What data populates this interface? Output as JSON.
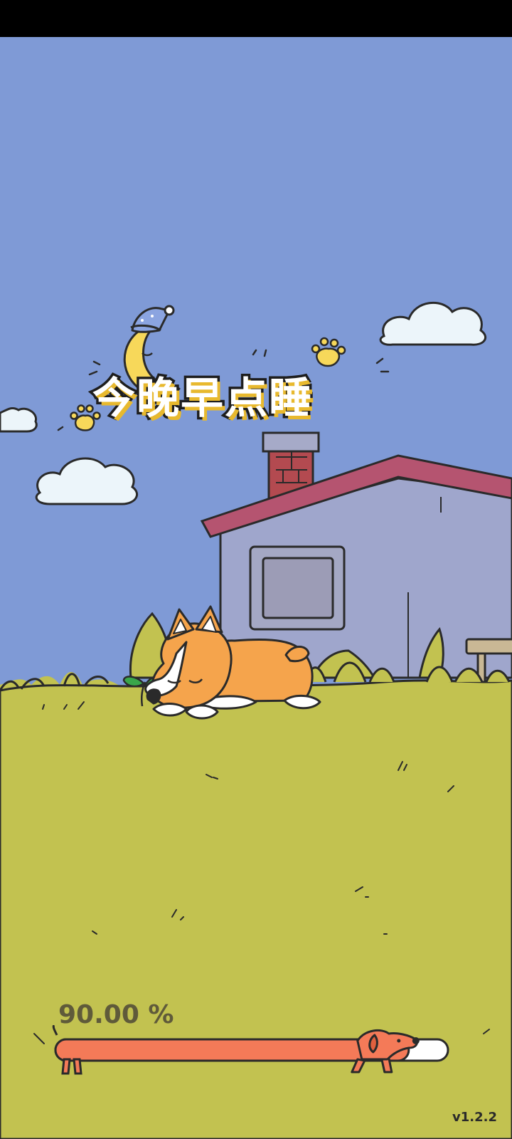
{
  "title": "今晚早点睡",
  "progress": {
    "percent_text": "90.00 %",
    "value": 0.9
  },
  "version": "v1.2.2",
  "colors": {
    "sky": "#7f9ad6",
    "grass": "#c2c250",
    "house_wall": "#9fa6cc",
    "roof": "#b55470",
    "chimney": "#b34a50",
    "progress_bar": "#f47a58",
    "progress_text": "#5f5a3a",
    "title_fill": "#ffffff",
    "title_shadow": "#e8b92e"
  },
  "icons": {
    "moon": "crescent-moon-with-nightcap-icon",
    "paw": "paw-print-icon",
    "mascot": "sleeping-corgi",
    "progress_runner": "dachshund-icon"
  }
}
